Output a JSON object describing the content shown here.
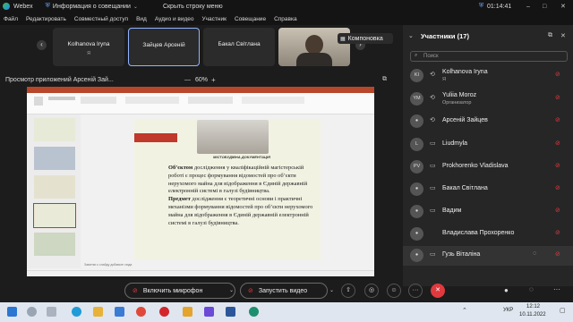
{
  "titlebar": {
    "app": "Webex",
    "meeting_info": "Информация о совещании",
    "hide_bar": "Скрыть строку меню",
    "time": "01:14:41"
  },
  "menu": [
    "Файл",
    "Редактировать",
    "Совместный доступ",
    "Вид",
    "Аудио и видео",
    "Участник",
    "Совещание",
    "Справка"
  ],
  "video_tiles": [
    {
      "name": "Kolhanova Iryna",
      "sub": "Я"
    },
    {
      "name": "Зайцев Арсеній",
      "sub": ""
    },
    {
      "name": "Бакал Світлана",
      "sub": ""
    }
  ],
  "layout_label": "Компоновка",
  "share": {
    "title": "Просмотр приложений Арсеній Зай...",
    "zoom": "60%",
    "minus": "—",
    "plus": "+"
  },
  "slide": {
    "caption": "МІСТОБУДІВНА ДОКУМЕНТАЦІЯ",
    "bold1": "Об’єктом",
    "text1": " дослідження у кваліфікаційній магістерській роботі є процес формування відомостей про об’єкти нерухомого майна для відображення в Єдиній державній електронній системі в галузі будівництва.",
    "bold2": "Предмет",
    "text2": " дослідження є теоретичні основи і практичні механізми формування відомостей про об’єкти нерухомого майна для відображення в Єдиній державній електронній системі в галузі будівництва.",
    "notes": "Заметки к слайду добавьте сюда"
  },
  "panel": {
    "title": "Участники (17)",
    "search_placeholder": "Поиск",
    "participants": [
      {
        "initials": "KI",
        "name": "Kolhanova Iryna",
        "sub": "Я"
      },
      {
        "initials": "YM",
        "name": "Yuliia Moroz",
        "sub": "Организатор"
      },
      {
        "initials": "",
        "name": "Арсеній Зайцев",
        "sub": ""
      },
      {
        "initials": "L",
        "name": "Liudmyla",
        "sub": ""
      },
      {
        "initials": "PV",
        "name": "Prokhorenko Vladislava",
        "sub": ""
      },
      {
        "initials": "",
        "name": "Бакал Світлана",
        "sub": ""
      },
      {
        "initials": "",
        "name": "Вадим",
        "sub": ""
      },
      {
        "initials": "",
        "name": "Владислава Прохоренко",
        "sub": ""
      },
      {
        "initials": "",
        "name": "Гузь Віталіна",
        "sub": ""
      }
    ]
  },
  "controls": {
    "mic": "Включить микрофон",
    "video": "Запустить видео",
    "more": "···",
    "leave": "✕"
  },
  "taskbar": {
    "lang": "УКР",
    "time": "12:12",
    "date": "10.11.2022"
  },
  "colors": {
    "leave": "#e0393e",
    "accent": "#3a78d6",
    "mic_off": "#e0393e",
    "slide_accent": "#c0392b"
  }
}
